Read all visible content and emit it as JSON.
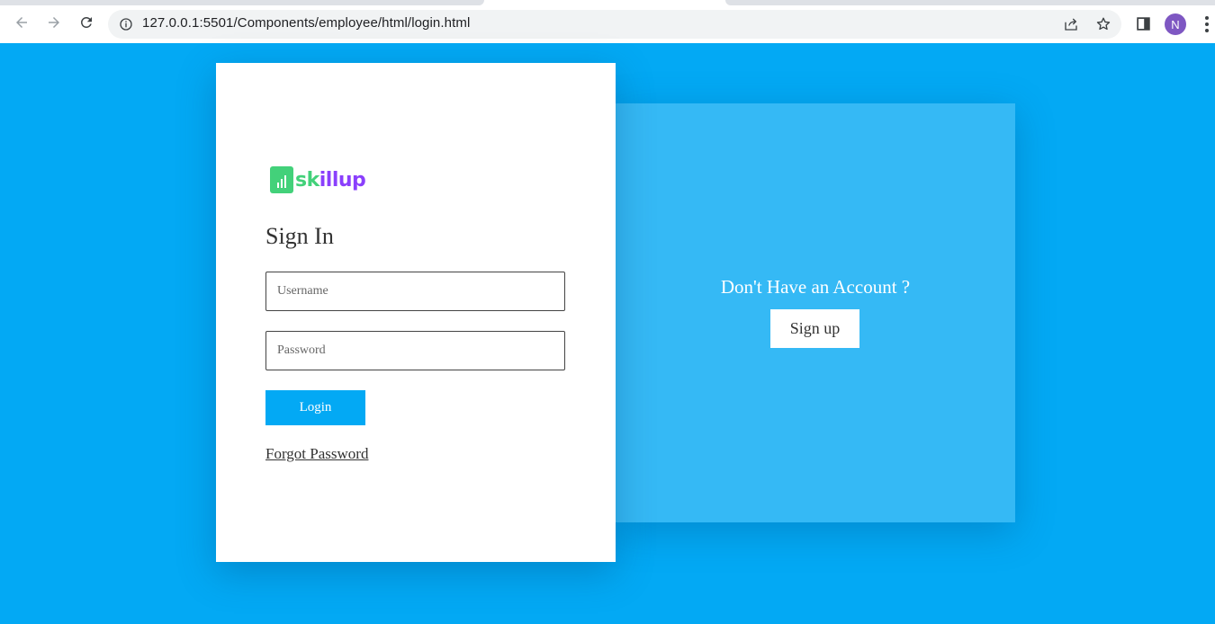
{
  "browser": {
    "url": "127.0.0.1:5501/Components/employee/html/login.html",
    "profile_initial": "N",
    "icons": [
      "back-arrow-icon",
      "forward-arrow-icon",
      "reload-icon",
      "site-info-icon",
      "share-icon",
      "bookmark-star-icon",
      "side-panel-icon",
      "more-menu-icon"
    ]
  },
  "login": {
    "logo_alt": "Skillup",
    "title": "Sign In",
    "username_placeholder": "Username",
    "password_placeholder": "Password",
    "login_label": "Login",
    "forgot_label": "Forgot Password"
  },
  "signup": {
    "prompt": "Don't Have an Account ?",
    "button_label": "Sign up"
  },
  "colors": {
    "page_background": "#03a9f4",
    "signup_panel": "#35b9f5",
    "logo_green": "#43d17a",
    "logo_purple": "#8a3ffc"
  }
}
